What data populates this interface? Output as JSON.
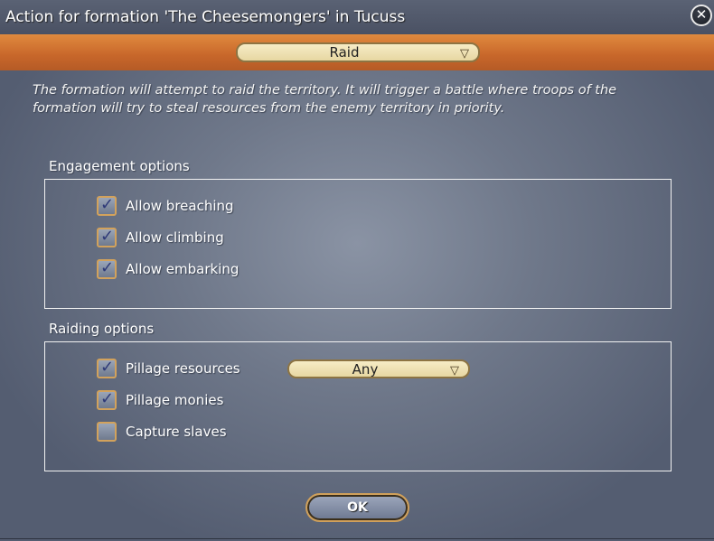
{
  "window": {
    "title": "Action for formation 'The Cheesemongers' in Tucuss",
    "close_glyph": "✕"
  },
  "action": {
    "selected": "Raid",
    "arrow_glyph": "▽"
  },
  "description": "The formation will attempt to raid the territory. It will trigger a battle where troops of the formation will try to steal resources from the enemy territory in priority.",
  "engagement": {
    "label": "Engagement options",
    "options": [
      {
        "label": "Allow breaching",
        "checked": true
      },
      {
        "label": "Allow climbing",
        "checked": true
      },
      {
        "label": "Allow embarking",
        "checked": true
      }
    ]
  },
  "raiding": {
    "label": "Raiding options",
    "options": [
      {
        "label": "Pillage resources",
        "checked": true
      },
      {
        "label": "Pillage monies",
        "checked": true
      },
      {
        "label": "Capture slaves",
        "checked": false
      }
    ],
    "resource_filter": {
      "selected": "Any",
      "arrow_glyph": "▽"
    }
  },
  "buttons": {
    "ok_label": "OK"
  },
  "check_glyph": "✓"
}
